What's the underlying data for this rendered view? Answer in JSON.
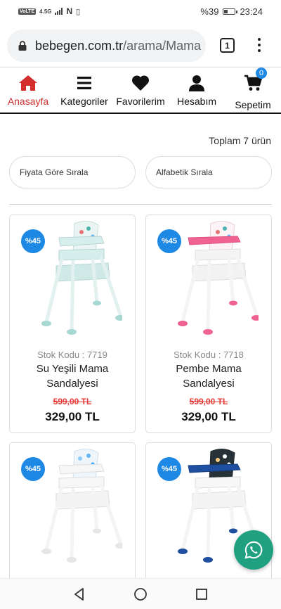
{
  "status_bar": {
    "carrier": "VoLTE",
    "network": "4.5G",
    "battery": "%39",
    "time": "23:24"
  },
  "browser": {
    "url_host": "bebegen.com.tr",
    "url_path": "/arama/Mama",
    "tab_count": "1"
  },
  "nav": {
    "items": [
      {
        "label": "Anasayfa",
        "icon": "home-icon",
        "active": true
      },
      {
        "label": "Kategoriler",
        "icon": "menu-icon"
      },
      {
        "label": "Favorilerim",
        "icon": "heart-icon"
      },
      {
        "label": "Hesabım",
        "icon": "user-icon"
      },
      {
        "label": "Sepetim",
        "icon": "cart-icon"
      }
    ],
    "cart_count": "0",
    "active_color": "#d32f2f"
  },
  "results": {
    "total": "Toplam 7 ürün",
    "sort_price": "Fiyata Göre Sırala",
    "sort_alpha": "Alfabetik Sırala"
  },
  "products": [
    {
      "discount": "%45",
      "stock": "Stok Kodu : 7719",
      "name": "Su Yeşili Mama Sandalyesi",
      "old_price": "599,00 TL",
      "price": "329,00 TL",
      "color": "#cfe9e6"
    },
    {
      "discount": "%45",
      "stock": "Stok Kodu : 7718",
      "name": "Pembe Mama Sandalyesi",
      "old_price": "599,00 TL",
      "price": "329,00 TL",
      "color": "#f06292"
    },
    {
      "discount": "%45",
      "color": "#90caf9"
    },
    {
      "discount": "%45",
      "color": "#1e4fa0"
    }
  ],
  "colors": {
    "badge": "#1e88e5",
    "old_price": "#e53935",
    "whatsapp": "#1fa181"
  }
}
